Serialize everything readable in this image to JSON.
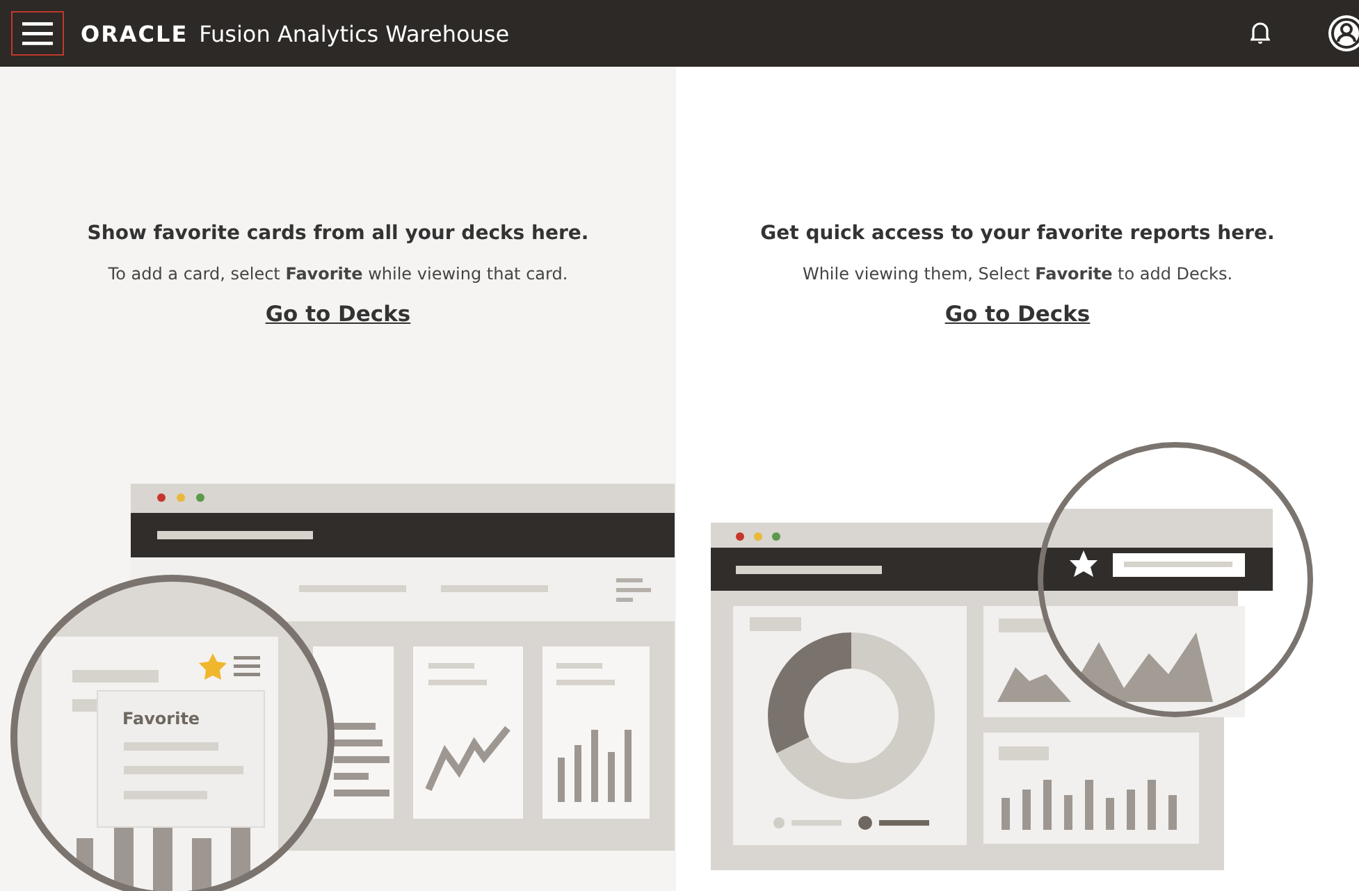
{
  "header": {
    "logo": "ORACLE",
    "title": "Fusion Analytics Warehouse"
  },
  "panels": [
    {
      "kind": "cards",
      "heading": "Show favorite cards from all your decks here.",
      "description": "To add a card, select **Favorite** while viewing that card.",
      "link": "Go to Decks",
      "popup_label": "Favorite"
    },
    {
      "kind": "reports",
      "heading": "Get quick access to your favorite reports here.",
      "description": "While viewing them, Select **Favorite** to add Decks.",
      "link": "Go to Decks"
    }
  ]
}
